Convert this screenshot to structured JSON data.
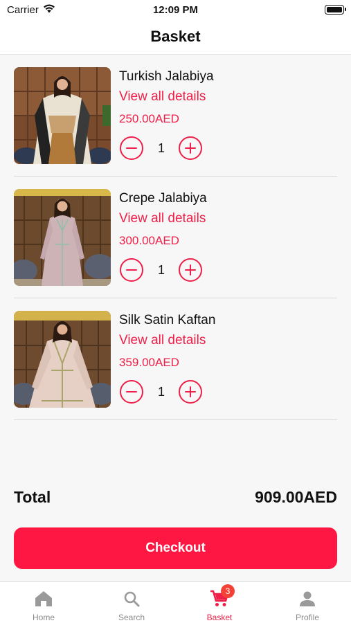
{
  "status_bar": {
    "carrier": "Carrier",
    "time": "12:09 PM"
  },
  "header": {
    "title": "Basket"
  },
  "items": [
    {
      "name": "Turkish Jalabiya",
      "details_link": "View all details",
      "price": "250.00AED",
      "quantity": "1",
      "image": "turkish-jalabiya-photo"
    },
    {
      "name": "Crepe Jalabiya",
      "details_link": "View all details",
      "price": "300.00AED",
      "quantity": "1",
      "image": "crepe-jalabiya-photo"
    },
    {
      "name": "Silk Satin Kaftan",
      "details_link": "View all details",
      "price": "359.00AED",
      "quantity": "1",
      "image": "silk-satin-kaftan-photo"
    }
  ],
  "summary": {
    "total_label": "Total",
    "total_value": "909.00AED"
  },
  "checkout": {
    "label": "Checkout"
  },
  "tabs": [
    {
      "label": "Home",
      "icon": "home-icon"
    },
    {
      "label": "Search",
      "icon": "search-icon"
    },
    {
      "label": "Basket",
      "icon": "cart-icon",
      "badge": "3",
      "active": true
    },
    {
      "label": "Profile",
      "icon": "profile-icon"
    }
  ],
  "colors": {
    "accent": "#ee1f48",
    "button": "#ff1744",
    "badge": "#f44336",
    "background": "#f7f7f7"
  }
}
